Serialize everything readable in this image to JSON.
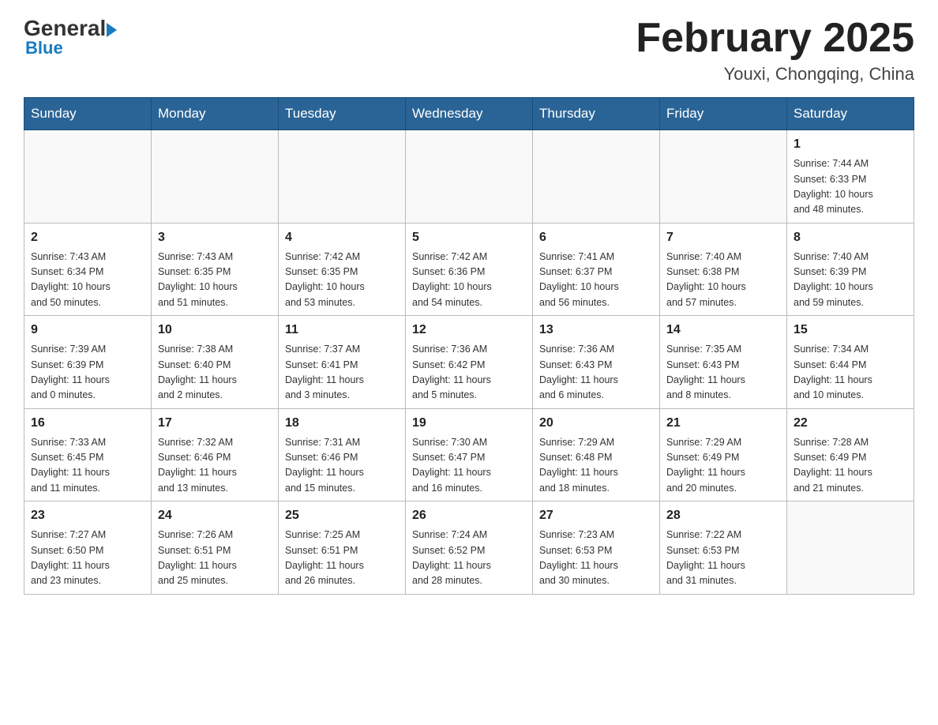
{
  "header": {
    "logo_general": "General",
    "logo_blue": "Blue",
    "month_title": "February 2025",
    "location": "Youxi, Chongqing, China"
  },
  "weekdays": [
    "Sunday",
    "Monday",
    "Tuesday",
    "Wednesday",
    "Thursday",
    "Friday",
    "Saturday"
  ],
  "weeks": [
    [
      {
        "day": "",
        "info": ""
      },
      {
        "day": "",
        "info": ""
      },
      {
        "day": "",
        "info": ""
      },
      {
        "day": "",
        "info": ""
      },
      {
        "day": "",
        "info": ""
      },
      {
        "day": "",
        "info": ""
      },
      {
        "day": "1",
        "info": "Sunrise: 7:44 AM\nSunset: 6:33 PM\nDaylight: 10 hours\nand 48 minutes."
      }
    ],
    [
      {
        "day": "2",
        "info": "Sunrise: 7:43 AM\nSunset: 6:34 PM\nDaylight: 10 hours\nand 50 minutes."
      },
      {
        "day": "3",
        "info": "Sunrise: 7:43 AM\nSunset: 6:35 PM\nDaylight: 10 hours\nand 51 minutes."
      },
      {
        "day": "4",
        "info": "Sunrise: 7:42 AM\nSunset: 6:35 PM\nDaylight: 10 hours\nand 53 minutes."
      },
      {
        "day": "5",
        "info": "Sunrise: 7:42 AM\nSunset: 6:36 PM\nDaylight: 10 hours\nand 54 minutes."
      },
      {
        "day": "6",
        "info": "Sunrise: 7:41 AM\nSunset: 6:37 PM\nDaylight: 10 hours\nand 56 minutes."
      },
      {
        "day": "7",
        "info": "Sunrise: 7:40 AM\nSunset: 6:38 PM\nDaylight: 10 hours\nand 57 minutes."
      },
      {
        "day": "8",
        "info": "Sunrise: 7:40 AM\nSunset: 6:39 PM\nDaylight: 10 hours\nand 59 minutes."
      }
    ],
    [
      {
        "day": "9",
        "info": "Sunrise: 7:39 AM\nSunset: 6:39 PM\nDaylight: 11 hours\nand 0 minutes."
      },
      {
        "day": "10",
        "info": "Sunrise: 7:38 AM\nSunset: 6:40 PM\nDaylight: 11 hours\nand 2 minutes."
      },
      {
        "day": "11",
        "info": "Sunrise: 7:37 AM\nSunset: 6:41 PM\nDaylight: 11 hours\nand 3 minutes."
      },
      {
        "day": "12",
        "info": "Sunrise: 7:36 AM\nSunset: 6:42 PM\nDaylight: 11 hours\nand 5 minutes."
      },
      {
        "day": "13",
        "info": "Sunrise: 7:36 AM\nSunset: 6:43 PM\nDaylight: 11 hours\nand 6 minutes."
      },
      {
        "day": "14",
        "info": "Sunrise: 7:35 AM\nSunset: 6:43 PM\nDaylight: 11 hours\nand 8 minutes."
      },
      {
        "day": "15",
        "info": "Sunrise: 7:34 AM\nSunset: 6:44 PM\nDaylight: 11 hours\nand 10 minutes."
      }
    ],
    [
      {
        "day": "16",
        "info": "Sunrise: 7:33 AM\nSunset: 6:45 PM\nDaylight: 11 hours\nand 11 minutes."
      },
      {
        "day": "17",
        "info": "Sunrise: 7:32 AM\nSunset: 6:46 PM\nDaylight: 11 hours\nand 13 minutes."
      },
      {
        "day": "18",
        "info": "Sunrise: 7:31 AM\nSunset: 6:46 PM\nDaylight: 11 hours\nand 15 minutes."
      },
      {
        "day": "19",
        "info": "Sunrise: 7:30 AM\nSunset: 6:47 PM\nDaylight: 11 hours\nand 16 minutes."
      },
      {
        "day": "20",
        "info": "Sunrise: 7:29 AM\nSunset: 6:48 PM\nDaylight: 11 hours\nand 18 minutes."
      },
      {
        "day": "21",
        "info": "Sunrise: 7:29 AM\nSunset: 6:49 PM\nDaylight: 11 hours\nand 20 minutes."
      },
      {
        "day": "22",
        "info": "Sunrise: 7:28 AM\nSunset: 6:49 PM\nDaylight: 11 hours\nand 21 minutes."
      }
    ],
    [
      {
        "day": "23",
        "info": "Sunrise: 7:27 AM\nSunset: 6:50 PM\nDaylight: 11 hours\nand 23 minutes."
      },
      {
        "day": "24",
        "info": "Sunrise: 7:26 AM\nSunset: 6:51 PM\nDaylight: 11 hours\nand 25 minutes."
      },
      {
        "day": "25",
        "info": "Sunrise: 7:25 AM\nSunset: 6:51 PM\nDaylight: 11 hours\nand 26 minutes."
      },
      {
        "day": "26",
        "info": "Sunrise: 7:24 AM\nSunset: 6:52 PM\nDaylight: 11 hours\nand 28 minutes."
      },
      {
        "day": "27",
        "info": "Sunrise: 7:23 AM\nSunset: 6:53 PM\nDaylight: 11 hours\nand 30 minutes."
      },
      {
        "day": "28",
        "info": "Sunrise: 7:22 AM\nSunset: 6:53 PM\nDaylight: 11 hours\nand 31 minutes."
      },
      {
        "day": "",
        "info": ""
      }
    ]
  ]
}
